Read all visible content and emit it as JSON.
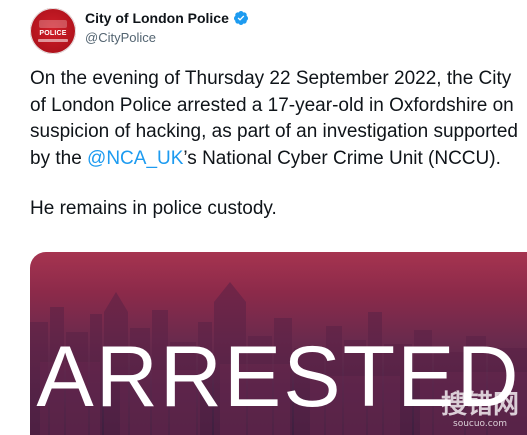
{
  "account": {
    "display_name": "City of London Police",
    "handle": "@CityPolice",
    "avatar_text": "CITY OF LONDON POLICE",
    "verified_color": "#1d9bf0"
  },
  "tweet": {
    "text_before_mention": "On the evening of Thursday 22 September 2022, the City of London Police arrested a 17-year-old in Oxfordshire on suspicion of hacking, as part of an investigation supported by the ",
    "mention": "@NCA_UK",
    "text_after_mention": "’s National Cyber Crime Unit (NCCU).",
    "second_paragraph": "He remains in police custody."
  },
  "media": {
    "headline": "ARRESTED",
    "watermark_main": "搜错网",
    "watermark_sub": "soucuo.com"
  },
  "colors": {
    "mention": "#1d9bf0",
    "media_top": "#a63450",
    "media_bottom": "#3e1f3f"
  }
}
